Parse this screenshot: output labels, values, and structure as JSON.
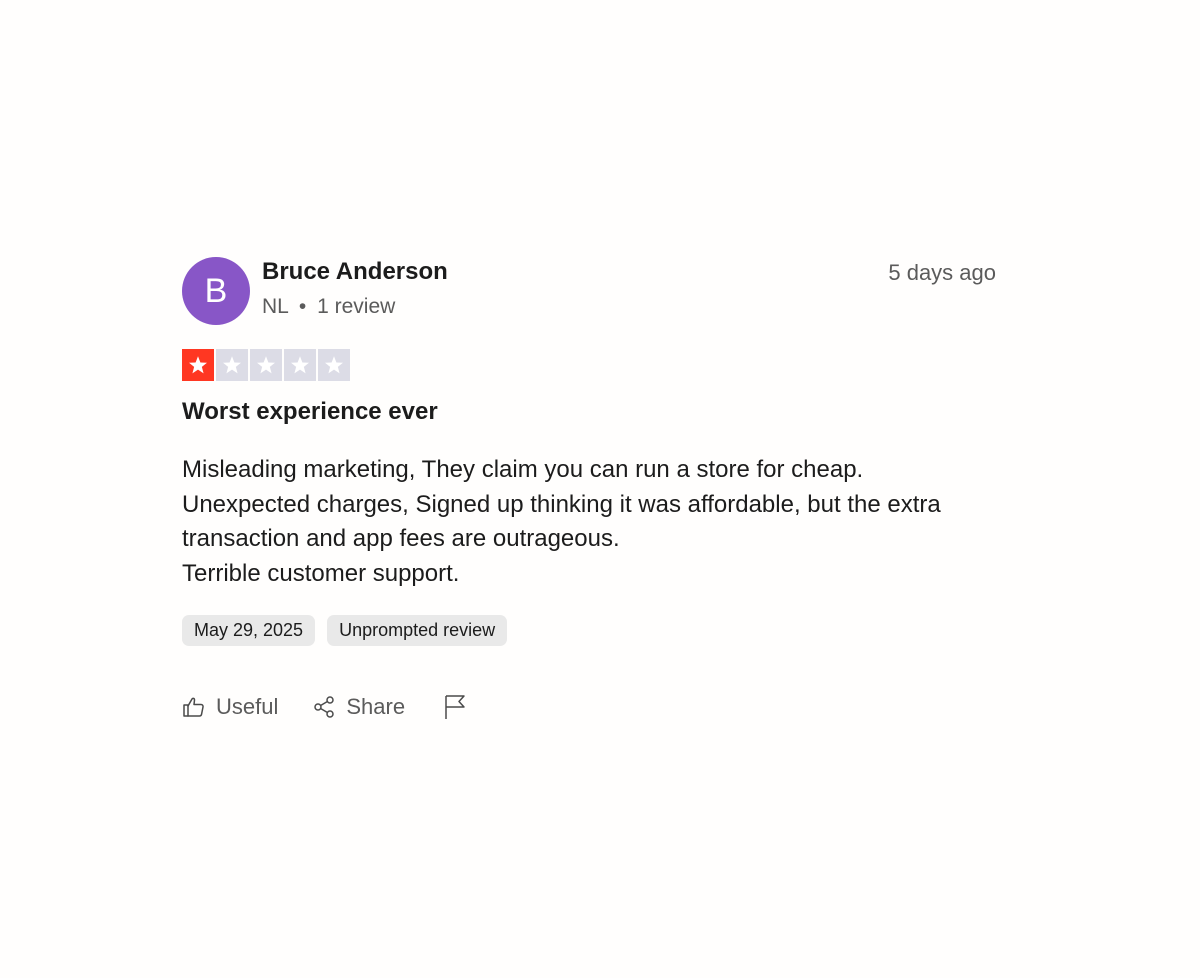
{
  "reviewer": {
    "avatar_initial": "B",
    "avatar_color": "#8856c7",
    "name": "Bruce Anderson",
    "country": "NL",
    "separator": "•",
    "review_count": "1 review"
  },
  "posted_ago": "5 days ago",
  "rating": {
    "value": 1,
    "max": 5,
    "filled_color": "#ff3722",
    "empty_color": "#dcdce6"
  },
  "review": {
    "title": "Worst experience ever",
    "lines": [
      "Misleading marketing, They claim you can run a store for cheap.",
      "Unexpected charges, Signed up thinking it was affordable, but the extra transaction and app fees are outrageous.",
      "Terrible customer support."
    ]
  },
  "tags": {
    "date": "May 29, 2025",
    "type": "Unprompted review"
  },
  "actions": {
    "useful_label": "Useful",
    "share_label": "Share",
    "useful_icon": "thumbs-up-icon",
    "share_icon": "share-icon",
    "report_icon": "flag-icon"
  }
}
